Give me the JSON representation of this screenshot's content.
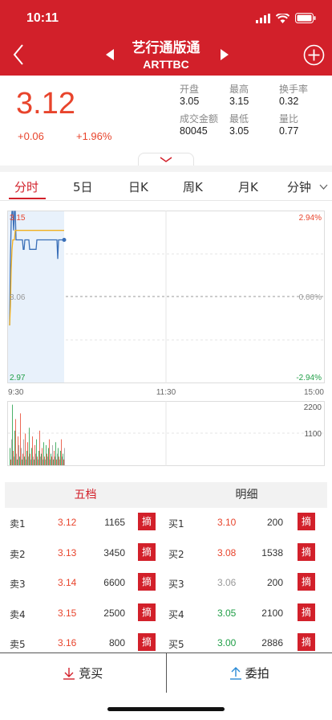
{
  "status": {
    "time": "10:11"
  },
  "nav": {
    "title": "艺行通版通",
    "subtitle": "ARTTBC"
  },
  "quote": {
    "price": "3.12",
    "change": "+0.06",
    "change_pct": "+1.96%",
    "stats": [
      {
        "label": "开盘",
        "value": "3.05"
      },
      {
        "label": "最高",
        "value": "3.15"
      },
      {
        "label": "换手率",
        "value": "0.32"
      },
      {
        "label": "成交金额",
        "value": "80045"
      },
      {
        "label": "最低",
        "value": "3.05"
      },
      {
        "label": "量比",
        "value": "0.77"
      }
    ]
  },
  "tabs": [
    "分时",
    "5日",
    "日K",
    "周K",
    "月K",
    "分钟"
  ],
  "chart": {
    "y_max_label": "3.15",
    "y_mid_label": "3.06",
    "y_min_label": "2.97",
    "pct_max_label": "2.94%",
    "pct_mid_label": "0.00%",
    "pct_min_label": "-2.94%",
    "x_labels": [
      "9:30",
      "11:30",
      "15:00"
    ],
    "vol_labels": [
      "2200",
      "1100"
    ]
  },
  "chart_data": {
    "type": "line",
    "title": "",
    "xlabel": "",
    "ylabel": "",
    "ylim": [
      2.97,
      3.15
    ],
    "x_range": [
      "9:30",
      "15:00"
    ],
    "series": [
      {
        "values": [
          3.03,
          3.1,
          3.14,
          3.15,
          3.15,
          3.13,
          3.15,
          3.15,
          3.12,
          3.12,
          3.12,
          3.12,
          3.12,
          3.12,
          3.12,
          3.12,
          3.12,
          3.11,
          3.11,
          3.12,
          3.12,
          3.12,
          3.12,
          3.12,
          3.12,
          3.11,
          3.11,
          3.11,
          3.11,
          3.11,
          3.11,
          3.11,
          3.11,
          3.11,
          3.12,
          3.12,
          3.12,
          3.12,
          3.12,
          3.12,
          3.12,
          3.12,
          3.12,
          3.12,
          3.12,
          3.12,
          3.12,
          3.12,
          3.12,
          3.12,
          3.12,
          3.12,
          3.12,
          3.12,
          3.12,
          3.12,
          3.12,
          3.12,
          3.12,
          3.12,
          3.1,
          3.12,
          3.12,
          3.12,
          3.12,
          3.12,
          3.12,
          3.12,
          3.12
        ]
      },
      {
        "values": [
          3.03,
          3.05,
          3.09,
          3.11,
          3.12,
          3.12,
          3.12,
          3.13,
          3.13,
          3.13,
          3.13,
          3.13,
          3.13,
          3.13,
          3.13,
          3.13,
          3.13,
          3.13,
          3.13,
          3.13,
          3.13,
          3.13,
          3.13,
          3.13,
          3.13,
          3.13,
          3.13,
          3.13,
          3.13,
          3.13,
          3.13,
          3.13,
          3.13,
          3.13,
          3.13,
          3.13,
          3.13,
          3.13,
          3.13,
          3.13,
          3.13,
          3.13,
          3.13,
          3.13,
          3.13,
          3.13,
          3.13,
          3.13,
          3.13,
          3.13,
          3.13,
          3.13,
          3.13,
          3.13,
          3.13,
          3.13,
          3.13,
          3.13,
          3.13,
          3.13,
          3.13,
          3.13,
          3.13,
          3.13,
          3.13,
          3.13,
          3.13,
          3.13,
          3.13
        ]
      }
    ],
    "volume": {
      "ylim": [
        0,
        2200
      ],
      "values": [
        600,
        200,
        900,
        2100,
        500,
        300,
        1200,
        1600,
        400,
        200,
        1000,
        700,
        300,
        1800,
        600,
        200,
        400,
        900,
        300,
        1100,
        200,
        500,
        800,
        300,
        1300,
        400,
        200,
        600,
        1000,
        300,
        200,
        700,
        400,
        900,
        300,
        200,
        500,
        1200,
        300,
        400,
        600,
        200,
        800,
        300,
        200,
        700,
        400,
        300,
        600,
        900,
        200,
        400,
        300,
        700,
        200,
        500,
        300,
        800,
        200,
        400,
        600,
        300,
        200,
        500,
        900,
        300,
        400,
        200,
        600
      ]
    }
  },
  "book": {
    "tab_five": "五档",
    "tab_detail": "明细",
    "sell": [
      {
        "label": "卖1",
        "price": "3.12",
        "qty": "1165",
        "color": "#e8442c"
      },
      {
        "label": "卖2",
        "price": "3.13",
        "qty": "3450",
        "color": "#e8442c"
      },
      {
        "label": "卖3",
        "price": "3.14",
        "qty": "6600",
        "color": "#e8442c"
      },
      {
        "label": "卖4",
        "price": "3.15",
        "qty": "2500",
        "color": "#e8442c"
      },
      {
        "label": "卖5",
        "price": "3.16",
        "qty": "800",
        "color": "#e8442c"
      }
    ],
    "buy": [
      {
        "label": "买1",
        "price": "3.10",
        "qty": "200",
        "color": "#e8442c"
      },
      {
        "label": "买2",
        "price": "3.08",
        "qty": "1538",
        "color": "#e8442c"
      },
      {
        "label": "买3",
        "price": "3.06",
        "qty": "200",
        "color": "#999999"
      },
      {
        "label": "买4",
        "price": "3.05",
        "qty": "2100",
        "color": "#1f9e46"
      },
      {
        "label": "买5",
        "price": "3.00",
        "qty": "2886",
        "color": "#1f9e46"
      }
    ],
    "take_label": "摘"
  },
  "actions": {
    "buy": "竞买",
    "entrust": "委拍"
  },
  "colors": {
    "brand": "#d2202a",
    "up": "#e8442c",
    "down": "#1f9e46"
  }
}
